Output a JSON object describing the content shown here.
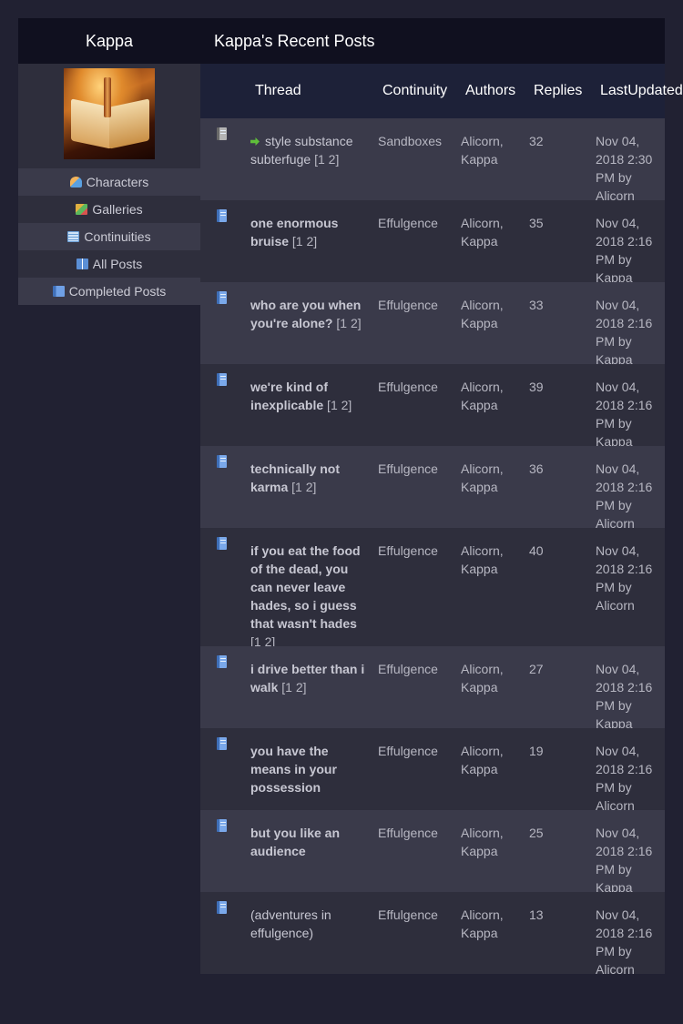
{
  "sidebar": {
    "username": "Kappa",
    "avatar_icon": "open-book-with-candle",
    "links": [
      {
        "label": "Characters",
        "icon": "characters-icon"
      },
      {
        "label": "Galleries",
        "icon": "galleries-icon"
      },
      {
        "label": "Continuities",
        "icon": "continuities-icon"
      },
      {
        "label": "All Posts",
        "icon": "all-posts-icon"
      },
      {
        "label": "Completed Posts",
        "icon": "completed-posts-icon"
      }
    ]
  },
  "main": {
    "title": "Kappa's Recent Posts",
    "columns": {
      "thread": "Thread",
      "continuity": "Continuity",
      "authors": "Authors",
      "replies": "Replies",
      "last_updated_1": "Last",
      "last_updated_2": "Updated"
    },
    "rows": [
      {
        "title": "style substance subterfuge",
        "bold": false,
        "unread_arrow": true,
        "icon": "grey-doc-icon",
        "pages": [
          "1",
          "2"
        ],
        "continuity": "Sandboxes",
        "authors": [
          "Alicorn",
          "Kappa"
        ],
        "replies": "32",
        "updated": "Nov 04, 2018 2:30 PM",
        "by": "Alicorn"
      },
      {
        "title": "one enormous bruise",
        "bold": true,
        "unread_arrow": false,
        "icon": "blue-doc-icon",
        "pages": [
          "1",
          "2"
        ],
        "continuity": "Effulgence",
        "authors": [
          "Alicorn",
          "Kappa"
        ],
        "replies": "35",
        "updated": "Nov 04, 2018 2:16 PM",
        "by": "Kappa"
      },
      {
        "title": "who are you when you're alone?",
        "bold": true,
        "unread_arrow": false,
        "icon": "blue-doc-icon",
        "pages": [
          "1",
          "2"
        ],
        "continuity": "Effulgence",
        "authors": [
          "Alicorn",
          "Kappa"
        ],
        "replies": "33",
        "updated": "Nov 04, 2018 2:16 PM",
        "by": "Kappa"
      },
      {
        "title": "we're kind of inexplicable",
        "bold": true,
        "unread_arrow": false,
        "icon": "blue-doc-icon",
        "pages": [
          "1",
          "2"
        ],
        "continuity": "Effulgence",
        "authors": [
          "Alicorn",
          "Kappa"
        ],
        "replies": "39",
        "updated": "Nov 04, 2018 2:16 PM",
        "by": "Kappa"
      },
      {
        "title": "technically not karma",
        "bold": true,
        "unread_arrow": false,
        "icon": "blue-doc-icon",
        "pages": [
          "1",
          "2"
        ],
        "continuity": "Effulgence",
        "authors": [
          "Alicorn",
          "Kappa"
        ],
        "replies": "36",
        "updated": "Nov 04, 2018 2:16 PM",
        "by": "Alicorn"
      },
      {
        "title": "if you eat the food of the dead, you can never leave hades, so i guess that wasn't hades",
        "bold": true,
        "unread_arrow": false,
        "icon": "blue-doc-icon",
        "pages": [
          "1",
          "2"
        ],
        "continuity": "Effulgence",
        "authors": [
          "Alicorn",
          "Kappa"
        ],
        "replies": "40",
        "updated": "Nov 04, 2018 2:16 PM",
        "by": "Alicorn"
      },
      {
        "title": "i drive better than i walk",
        "bold": true,
        "unread_arrow": false,
        "icon": "blue-doc-icon",
        "pages": [
          "1",
          "2"
        ],
        "continuity": "Effulgence",
        "authors": [
          "Alicorn",
          "Kappa"
        ],
        "replies": "27",
        "updated": "Nov 04, 2018 2:16 PM",
        "by": "Kappa"
      },
      {
        "title": "you have the means in your possession",
        "bold": true,
        "unread_arrow": false,
        "icon": "blue-doc-icon",
        "pages": [],
        "continuity": "Effulgence",
        "authors": [
          "Alicorn",
          "Kappa"
        ],
        "replies": "19",
        "updated": "Nov 04, 2018 2:16 PM",
        "by": "Alicorn"
      },
      {
        "title": "but you like an audience",
        "bold": true,
        "unread_arrow": false,
        "icon": "blue-doc-icon",
        "pages": [],
        "continuity": "Effulgence",
        "authors": [
          "Alicorn",
          "Kappa"
        ],
        "replies": "25",
        "updated": "Nov 04, 2018 2:16 PM",
        "by": "Kappa"
      },
      {
        "title": "(adventures in effulgence)",
        "bold": false,
        "unread_arrow": false,
        "icon": "blue-doc-icon",
        "pages": [],
        "continuity": "Effulgence",
        "authors": [
          "Alicorn",
          "Kappa"
        ],
        "replies": "13",
        "updated": "Nov 04, 2018 2:16 PM",
        "by": "Alicorn"
      }
    ]
  }
}
